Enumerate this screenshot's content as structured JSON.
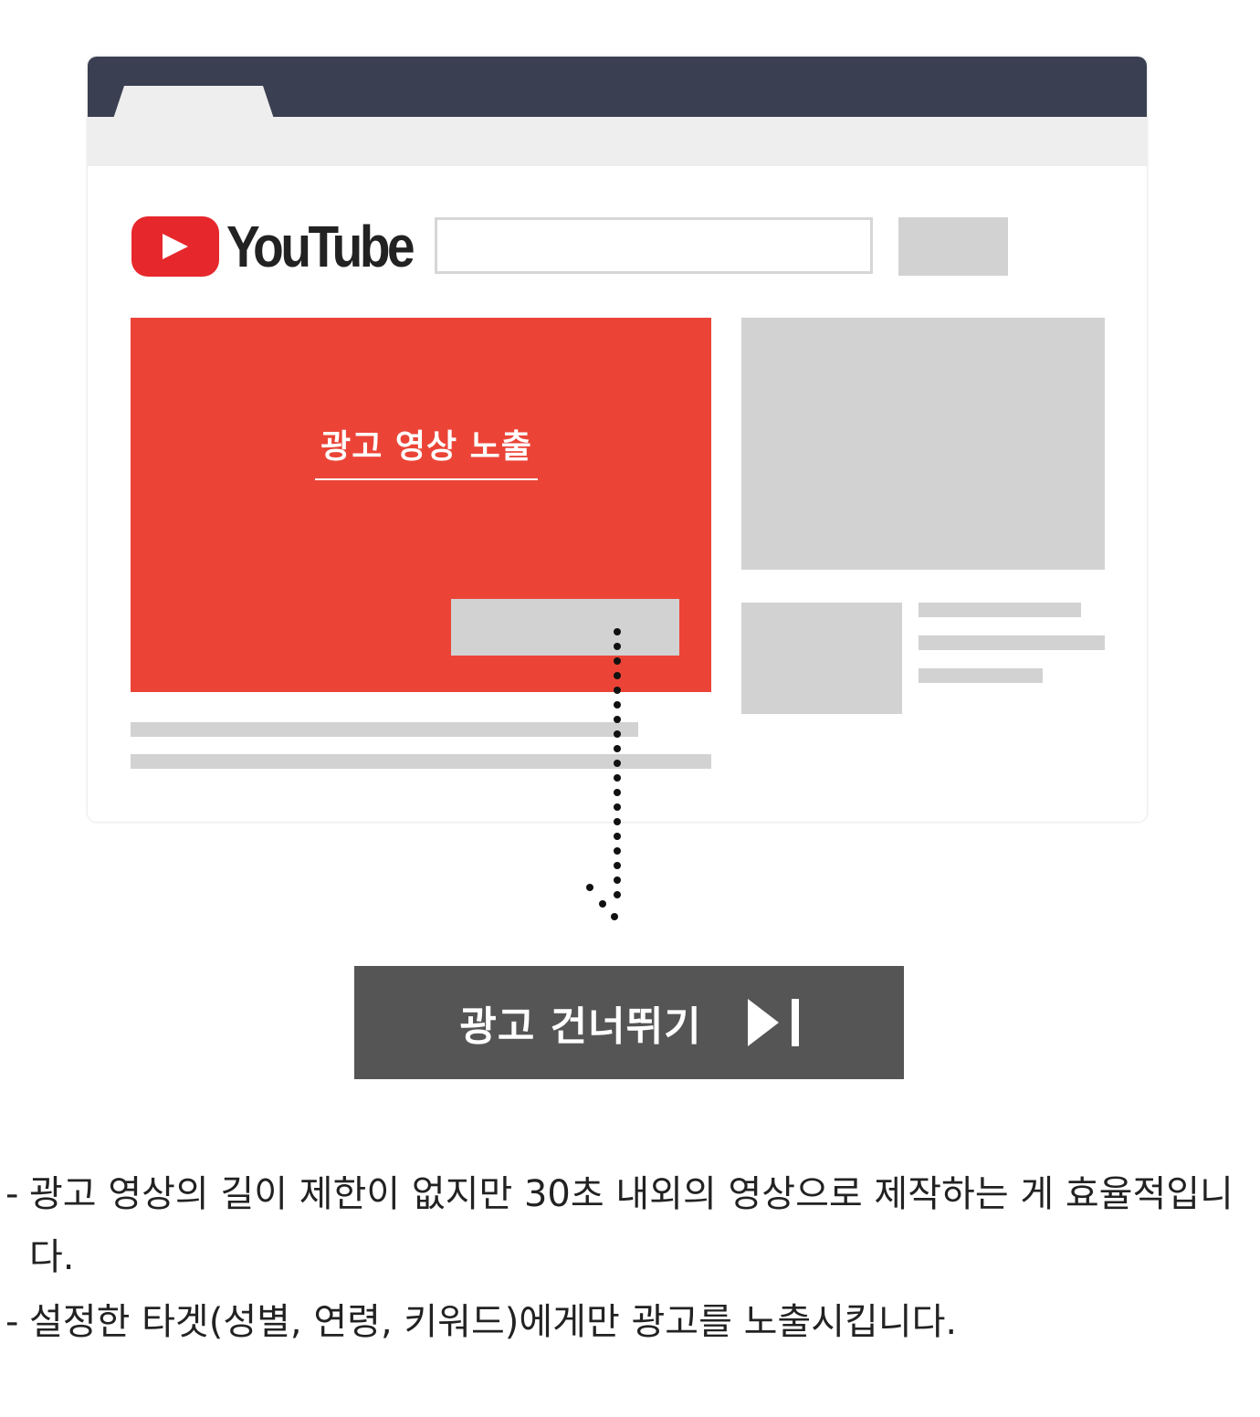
{
  "illustration": {
    "logo_text": "YouTube",
    "ad_video_label": "광고 영상 노출",
    "colors": {
      "browser_titlebar": "#3a3f51",
      "youtube_red": "#e6272c",
      "ad_video": "#eb4437",
      "placeholder_gray": "#d2d2d2"
    }
  },
  "skip_button": {
    "label": "광고 건너뛰기",
    "icon": "skip-next-icon",
    "color": "#555555"
  },
  "notes": [
    {
      "bullet": "-",
      "text": "광고 영상의 길이 제한이 없지만 30초 내외의 영상으로 제작하는 게 효율적입니다."
    },
    {
      "bullet": "-",
      "text": "설정한 타겟(성별, 연령, 키워드)에게만 광고를 노출시킵니다."
    }
  ]
}
